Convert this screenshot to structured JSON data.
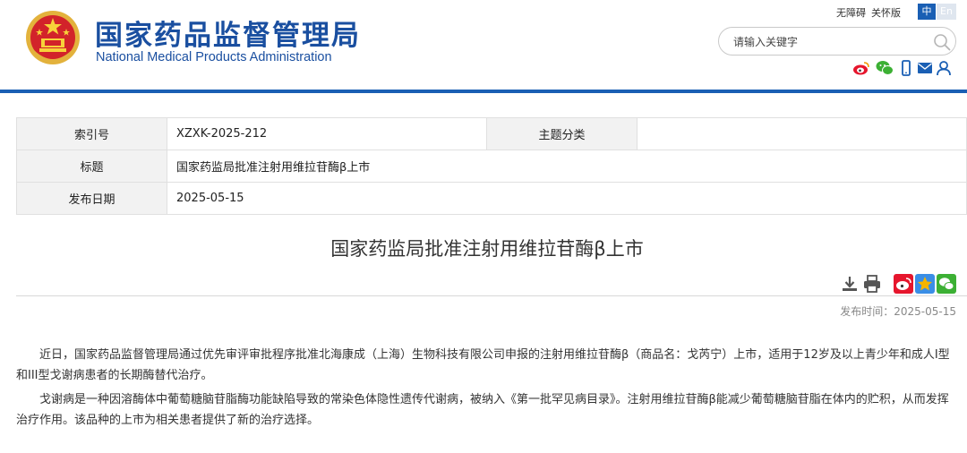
{
  "header": {
    "brand_cn": "国家药品监督管理局",
    "brand_en": "National Medical Products Administration",
    "accessibility_link": "无障碍",
    "care_version_link": "关怀版",
    "lang_cn": "中",
    "lang_en": "En",
    "search_placeholder": "请输入关键字",
    "share_icons": [
      "weibo-icon",
      "wechat-icon",
      "mobile-icon",
      "mail-icon",
      "user-icon"
    ]
  },
  "info": {
    "index_label": "索引号",
    "index_value": "XZXK-2025-212",
    "category_label": "主题分类",
    "category_value": "",
    "title_label": "标题",
    "title_value": "国家药监局批准注射用维拉苷酶β上市",
    "date_label": "发布日期",
    "date_value": "2025-05-15"
  },
  "article": {
    "title": "国家药监局批准注射用维拉苷酶β上市",
    "publish_time_label": "发布时间：",
    "publish_time": "2025-05-15",
    "paragraphs": [
      "近日，国家药品监督管理局通过优先审评审批程序批准北海康成（上海）生物科技有限公司申报的注射用维拉苷酶β（商品名：戈芮宁）上市，适用于12岁及以上青少年和成人I型和III型戈谢病患者的长期酶替代治疗。",
      "戈谢病是一种因溶酶体中葡萄糖脑苷脂酶功能缺陷导致的常染色体隐性遗传代谢病，被纳入《第一批罕见病目录》。注射用维拉苷酶β能减少葡萄糖脑苷脂在体内的贮积，从而发挥治疗作用。该品种的上市为相关患者提供了新的治疗选择。"
    ]
  },
  "colors": {
    "brand_blue": "#1a4fa0",
    "nav_blue": "#1a5fb4",
    "weibo_red": "#e6162d",
    "wechat_green": "#3cb034",
    "star_gold": "#f5b400"
  }
}
